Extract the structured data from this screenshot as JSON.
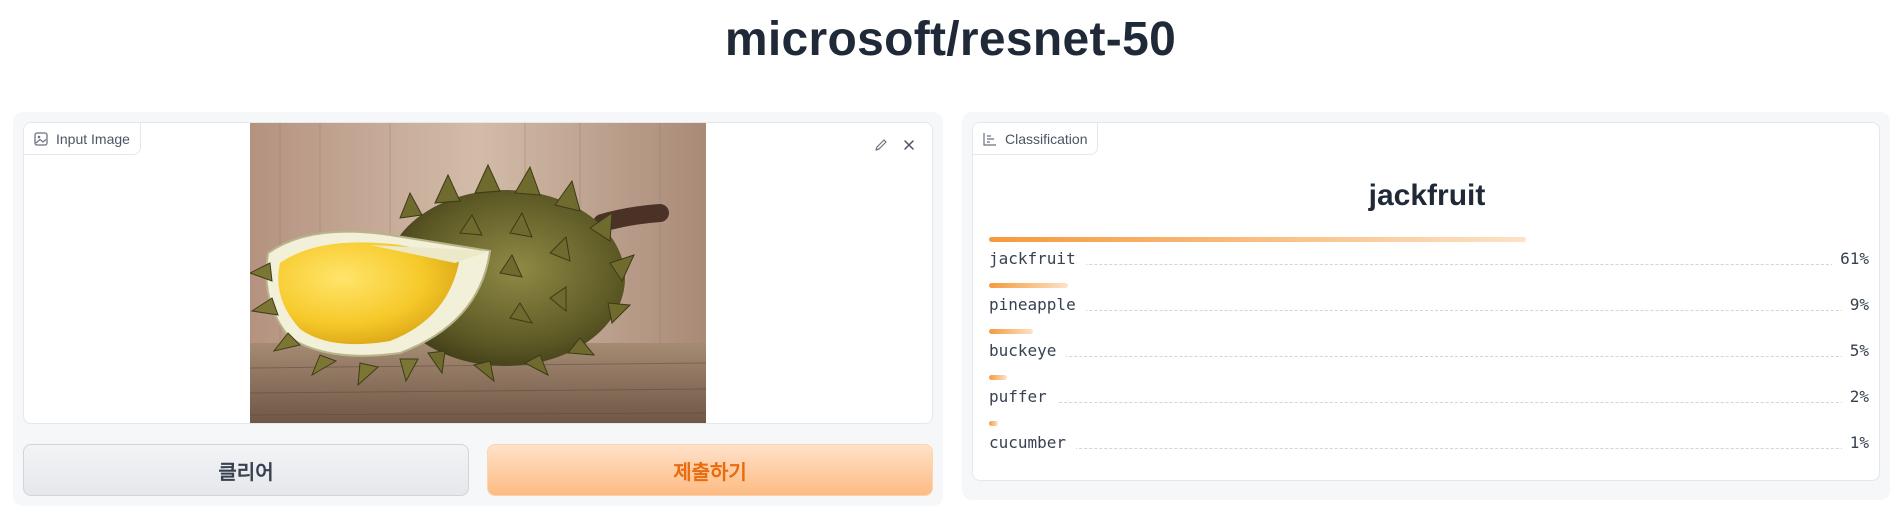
{
  "page": {
    "title": "microsoft/resnet-50"
  },
  "input": {
    "label": "Input Image",
    "icon": "image-icon",
    "tools": [
      "edit-icon",
      "close-icon"
    ]
  },
  "buttons": {
    "clear": "클리어",
    "submit": "제출하기"
  },
  "output": {
    "label": "Classification",
    "icon": "bar-chart-icon",
    "top_label": "jackfruit",
    "confidences": [
      {
        "label": "jackfruit",
        "value": "61%",
        "fraction": 0.61
      },
      {
        "label": "pineapple",
        "value": "9%",
        "fraction": 0.09
      },
      {
        "label": "buckeye",
        "value": "5%",
        "fraction": 0.05
      },
      {
        "label": "puffer",
        "value": "2%",
        "fraction": 0.02
      },
      {
        "label": "cucumber",
        "value": "1%",
        "fraction": 0.01
      }
    ]
  },
  "colors": {
    "accent": "#f97316",
    "bar_start": "#f59a3c",
    "bar_end": "#fde2c6",
    "submit_text": "#ea6a0c"
  }
}
